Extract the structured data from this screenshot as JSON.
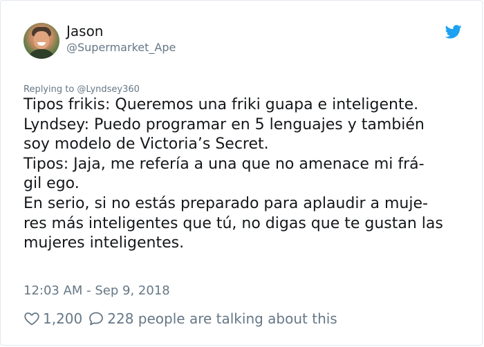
{
  "tweet": {
    "author": {
      "name": "Jason",
      "handle": "@Supermarket_Ape"
    },
    "replying_to": "Replying to @Lyndsey360",
    "lines": [
      "Tipos frikis: Queremos una friki guapa e inteligente.",
      "Lyndsey: Puedo programar en 5 lenguajes y también",
      "soy modelo de Victoria’s Secret.",
      "Tipos: Jaja, me refería a una que no amenace mi frá-",
      "gil ego.",
      "En serio, si no estás preparado para aplaudir a muje-",
      "res más inteligentes que tú, no digas que te gustan las",
      "mujeres inteligentes."
    ],
    "timestamp": "12:03 AM - Sep 9, 2018",
    "likes": "1,200",
    "conversation": "228 people are talking about this",
    "icons": {
      "brand": "twitter-bird-icon",
      "like": "heart-icon",
      "reply": "speech-bubble-icon"
    },
    "colors": {
      "brand": "#1da1f2",
      "text": "#14171a",
      "secondary": "#657786"
    }
  }
}
